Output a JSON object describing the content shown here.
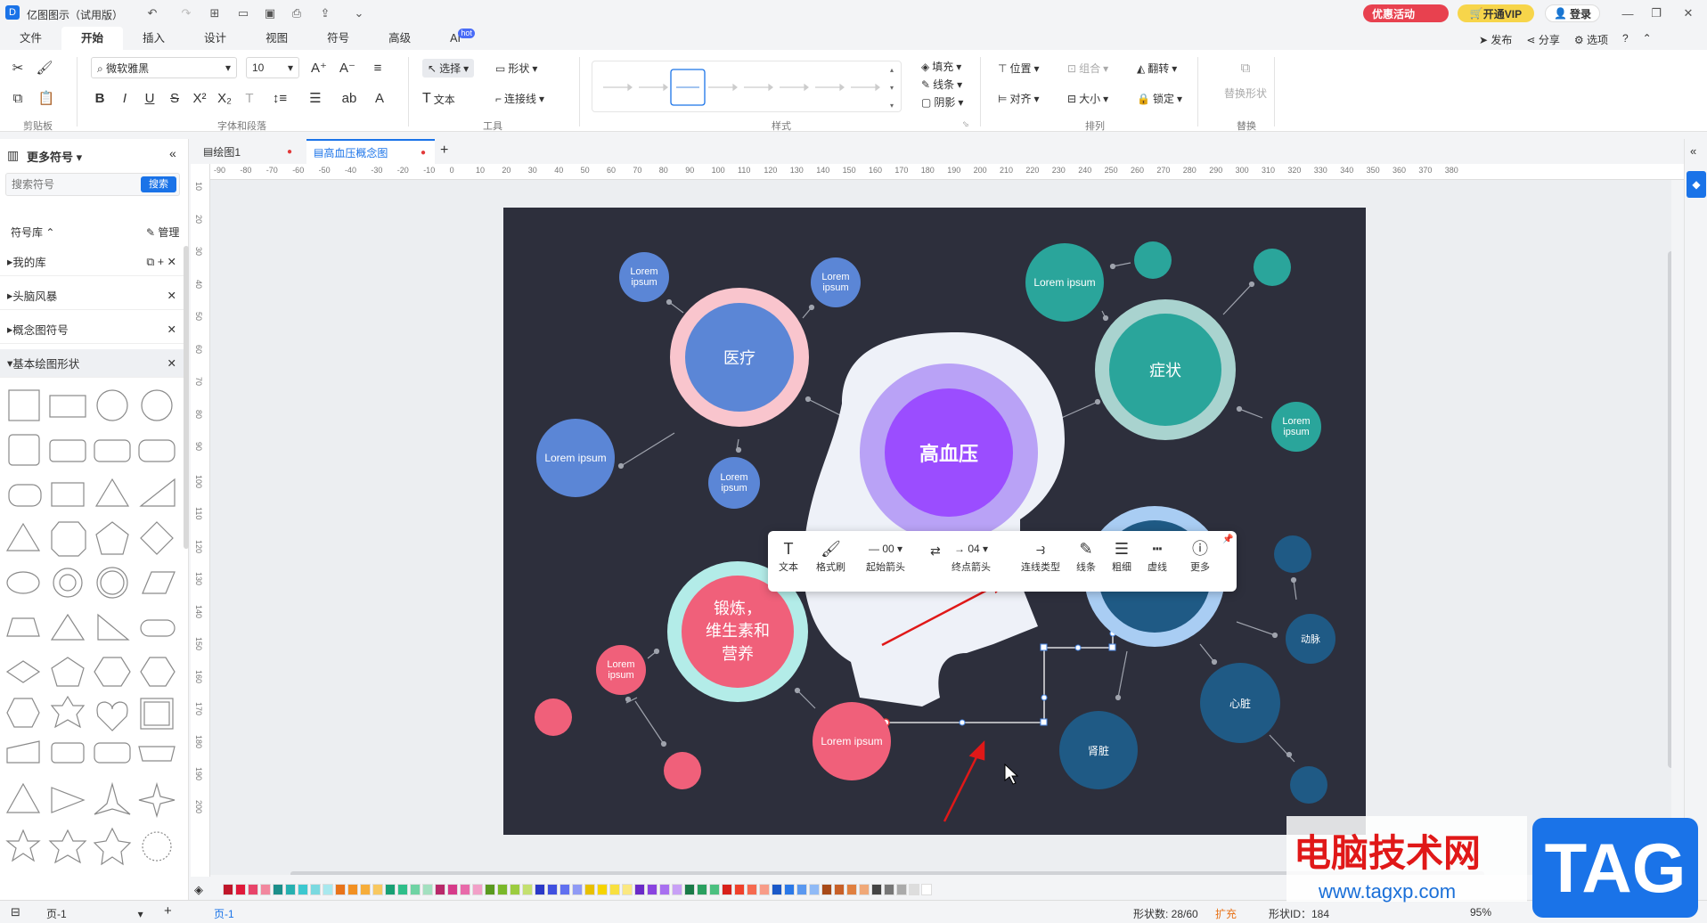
{
  "app": {
    "title": "亿图图示（试用版）",
    "promo": "优惠活动",
    "vip": "开通VIP",
    "login": "登录"
  },
  "menu": [
    "文件",
    "开始",
    "插入",
    "设计",
    "视图",
    "符号",
    "高级",
    "AI"
  ],
  "menu_ai_badge": "hot",
  "menu_right": {
    "publish": "发布",
    "share": "分享",
    "options": "选项"
  },
  "ribbon": {
    "font_name": "微软雅黑",
    "font_size": "10",
    "select": "选择",
    "shape": "形状",
    "text": "文本",
    "connector": "连接线",
    "fill": "填充",
    "line": "线条",
    "shadow": "阴影",
    "position": "位置",
    "group": "组合",
    "flip": "翻转",
    "align": "对齐",
    "size": "大小",
    "lock": "锁定",
    "replace_shape": "替换形状",
    "groups": {
      "clipboard": "剪贴板",
      "font": "字体和段落",
      "tools": "工具",
      "style": "样式",
      "arrange": "排列",
      "replace": "替换"
    }
  },
  "left": {
    "title": "更多符号",
    "search_placeholder": "搜索符号",
    "search_btn": "搜索",
    "lib_title": "符号库",
    "manage": "管理",
    "libs": [
      "我的库",
      "头脑风暴",
      "概念图符号",
      "基本绘图形状"
    ]
  },
  "tabs": [
    {
      "label": "绘图1"
    },
    {
      "label": "高血压概念图"
    }
  ],
  "hruler": [
    "-90",
    "-80",
    "-70",
    "-60",
    "-50",
    "-40",
    "-30",
    "-20",
    "-10",
    "0",
    "10",
    "20",
    "30",
    "40",
    "50",
    "60",
    "70",
    "80",
    "90",
    "100",
    "110",
    "120",
    "130",
    "140",
    "150",
    "160",
    "170",
    "180",
    "190",
    "200",
    "210",
    "220",
    "230",
    "240",
    "250",
    "260",
    "270",
    "280",
    "290",
    "300",
    "310",
    "320",
    "330",
    "340",
    "350",
    "360",
    "370",
    "380"
  ],
  "vruler": [
    "10",
    "20",
    "30",
    "40",
    "50",
    "60",
    "70",
    "80",
    "90",
    "100",
    "110",
    "120",
    "130",
    "140",
    "150",
    "160",
    "170",
    "180",
    "190",
    "200"
  ],
  "diagram": {
    "center": "高血压",
    "n_medical": "医疗",
    "n_symptom": "症状",
    "n_exercise": "锻炼，\n维生素和\n营养",
    "lorem": "Lorem ipsum",
    "lorem2": "Lorem\nipsum",
    "artery": "动脉",
    "heart": "心脏",
    "kidney": "肾脏"
  },
  "floattb": {
    "text": "文本",
    "brush": "格式刷",
    "start_arrow": "起始箭头",
    "start_val": "00",
    "end_arrow": "终点箭头",
    "end_val": "04",
    "conn_type": "连线类型",
    "line": "线条",
    "weight": "粗细",
    "dash": "虚线",
    "more": "更多"
  },
  "status": {
    "page": "页-1",
    "page_tab": "页-1",
    "shape_count": "形状数: 28/60",
    "expand": "扩充",
    "shape_id": "形状ID：184",
    "zoom": "95%"
  },
  "watermark": {
    "text": "电脑技术网",
    "url": "www.tagxp.com",
    "tag": "TAG"
  },
  "colors": {
    "accent": "#1a73e8",
    "bg_canvas": "#2d2f3c",
    "purple": "#9b4dff",
    "teal": "#2aa59b",
    "blue": "#5b86d6",
    "pink": "#f0607a",
    "navy": "#1f5a85"
  }
}
